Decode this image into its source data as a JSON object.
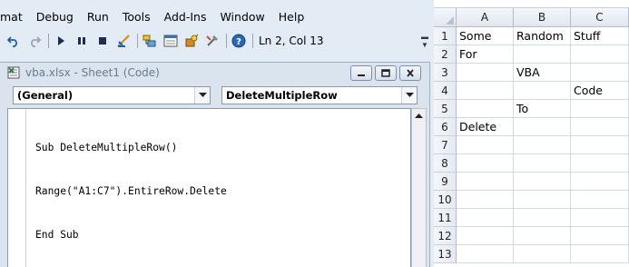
{
  "menu": [
    "mat",
    "Debug",
    "Run",
    "Tools",
    "Add-Ins",
    "Window",
    "Help"
  ],
  "toolbar": {
    "icons": [
      "undo-icon",
      "redo-icon",
      "run-icon",
      "break-icon",
      "reset-icon",
      "design-mode-icon",
      "project-explorer-icon",
      "properties-icon",
      "object-browser-icon",
      "toolbox-icon",
      "help-icon"
    ],
    "status": "Ln 2, Col 13"
  },
  "code_window": {
    "title": "vba.xlsx - Sheet1 (Code)",
    "object_combo": "(General)",
    "procedure_combo": "DeleteMultipleRow",
    "code_lines": [
      "Sub DeleteMultipleRow()",
      "Range(\"A1:C7\").EntireRow.Delete",
      "End Sub"
    ]
  },
  "sheet": {
    "columns": [
      "A",
      "B",
      "C"
    ],
    "rows": [
      {
        "num": "1",
        "cells": [
          "Some",
          "Random",
          "Stuff"
        ]
      },
      {
        "num": "2",
        "cells": [
          "For",
          "",
          ""
        ]
      },
      {
        "num": "3",
        "cells": [
          "",
          "VBA",
          ""
        ]
      },
      {
        "num": "4",
        "cells": [
          "",
          "",
          "Code"
        ]
      },
      {
        "num": "5",
        "cells": [
          "",
          "To",
          ""
        ]
      },
      {
        "num": "6",
        "cells": [
          "Delete",
          "",
          ""
        ]
      },
      {
        "num": "7",
        "cells": [
          "",
          "",
          ""
        ]
      },
      {
        "num": "8",
        "cells": [
          "",
          "",
          ""
        ]
      },
      {
        "num": "9",
        "cells": [
          "",
          "",
          ""
        ]
      },
      {
        "num": "10",
        "cells": [
          "",
          "",
          ""
        ]
      },
      {
        "num": "11",
        "cells": [
          "",
          "",
          ""
        ]
      },
      {
        "num": "12",
        "cells": [
          "",
          "",
          ""
        ]
      },
      {
        "num": "13",
        "cells": [
          "",
          "",
          ""
        ]
      }
    ]
  },
  "colors": {
    "ide_background": "#e3ebf5",
    "selection_outline": "#000000"
  }
}
